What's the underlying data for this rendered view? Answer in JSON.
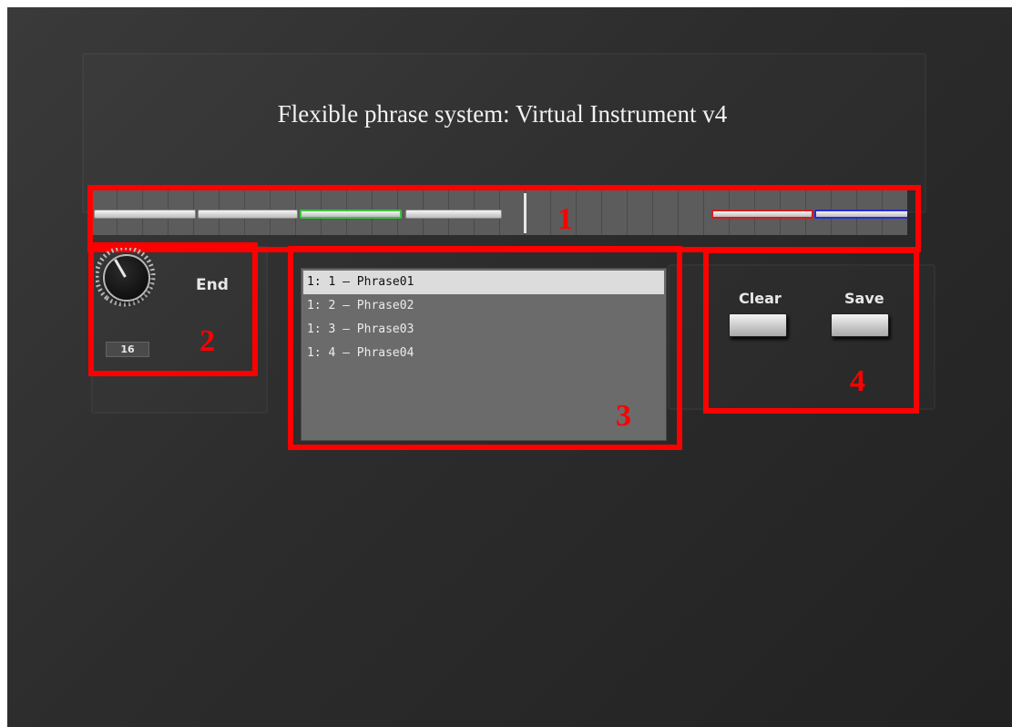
{
  "title": "Flexible phrase system: Virtual Instrument v4",
  "sections": {
    "timeline_number": "1",
    "knob_number": "2",
    "list_number": "3",
    "buttons_number": "4"
  },
  "knob": {
    "label": "End",
    "value": "16",
    "icon": "knob-icon"
  },
  "phrase_list": {
    "items": [
      "1: 1 – Phrase01",
      "1: 2 – Phrase02",
      "1: 3 – Phrase03",
      "1: 4 – Phrase04"
    ],
    "selected_index": 0
  },
  "buttons": {
    "clear_label": "Clear",
    "save_label": "Save"
  },
  "colors": {
    "annotation": "#ff0000",
    "phrase_highlight_green": "#3fc23f",
    "phrase_highlight_red": "#d21c1c",
    "phrase_highlight_blue": "#2a2ad8"
  }
}
